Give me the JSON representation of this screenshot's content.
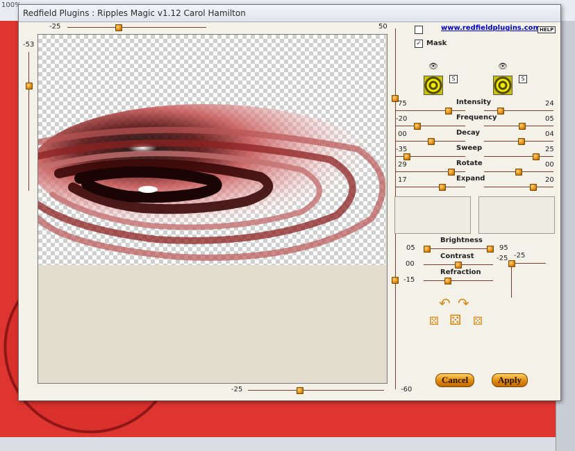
{
  "background": {
    "zoom_label": "100%"
  },
  "dialog": {
    "title": "Redfield Plugins : Ripples Magic v1.12   Carol Hamilton",
    "link": "www.redfieldplugins.com",
    "help": "HELP",
    "mask_label": "Mask",
    "top_slider": {
      "left": "-25",
      "right": "50"
    },
    "left_slider": {
      "value": "-53"
    },
    "bottom_slider": {
      "left": "-25",
      "right": "-60"
    },
    "thumb_buttons": [
      "S",
      "S"
    ],
    "params": [
      {
        "name": "Intensity",
        "left": "75",
        "right": "24"
      },
      {
        "name": "Frequency",
        "left": "-20",
        "right": "05"
      },
      {
        "name": "Decay",
        "left": "00",
        "right": "04"
      },
      {
        "name": "Sweep",
        "left": "-35",
        "right": "25"
      },
      {
        "name": "Rotate",
        "left": "29",
        "right": "00"
      },
      {
        "name": "Expand",
        "left": "17",
        "right": "20"
      }
    ],
    "light": {
      "brightness_label": "Brightness",
      "brightness_left": "05",
      "brightness_right": "95",
      "contrast_label": "Contrast",
      "contrast_value": "00",
      "refraction_label": "Refraction",
      "refraction_value": "-15",
      "cross_left": "-25",
      "cross_right": "-25"
    },
    "buttons": {
      "cancel": "Cancel",
      "apply": "Apply"
    }
  },
  "colors": {
    "accent": "#e08a10",
    "background_red": "#d9302c"
  }
}
